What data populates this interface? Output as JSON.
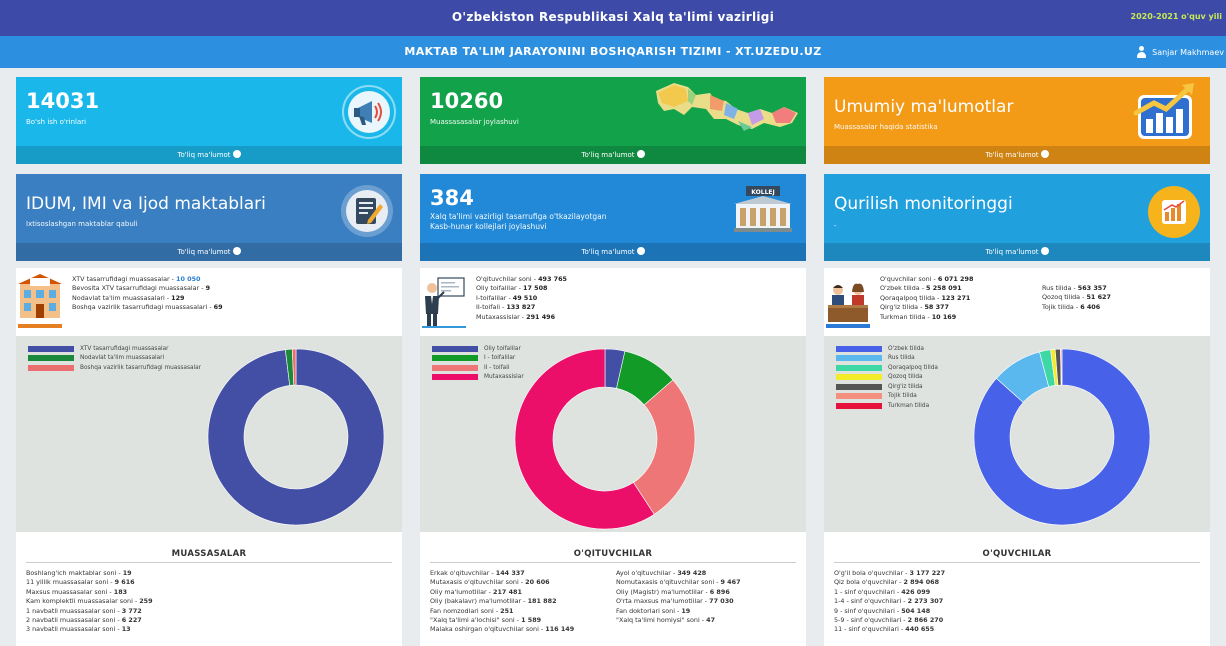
{
  "header": {
    "title": "O'zbekiston Respublikasi Xalq ta'limi vazirligi",
    "year": "2020-2021 o'quv yili"
  },
  "subheader": {
    "title": "MAKTAB TA'LIM JARAYONINI BOSHQARISH TIZIMI - XT.UZEDU.UZ",
    "user": "Sanjar Makhmaev"
  },
  "more_label": "To'liq ma'lumot",
  "cards": [
    {
      "value": "14031",
      "subtitle": "Bo'sh ish o'rinlari",
      "color": "#1ab8ea",
      "icon": "megaphone-icon"
    },
    {
      "value": "10260",
      "subtitle": "Muassasasalar joylashuvi",
      "color": "#12a24a",
      "icon": "map-icon"
    },
    {
      "title": "Umumiy ma'lumotlar",
      "subtitle": "Muassasalar haqida statistika",
      "color": "#f39a17",
      "icon": "growth-chart-icon"
    },
    {
      "title": "IDUM, IMI va Ijod maktablari",
      "subtitle": "Ixtisoslashgan maktablar qabuli",
      "color": "#3a7fc2",
      "icon": "edit-document-icon"
    },
    {
      "value": "384",
      "subtitle": "Xalq ta'limi vazirligi tasarrufiga o'tkazilayotgan",
      "subtitle2": "Kasb-hunar kollejlari joylashuvi",
      "color": "#2189d8",
      "icon": "college-building-icon",
      "icon_label": "KOLLEJ"
    },
    {
      "title": "Qurilish monitoringgi",
      "subtitle": "-",
      "color": "#21a0de",
      "icon": "bar-chart-icon"
    }
  ],
  "panels": {
    "institutions": {
      "info": [
        {
          "label": "XTV tasarrufidagi muassasalar - ",
          "value": "10 050"
        },
        {
          "label": "Bevosita XTV tasarrufidagi muassasalar - ",
          "value": "9"
        },
        {
          "label": "Nodavlat ta'lim muassasalari - ",
          "value": "129"
        },
        {
          "label": "Boshqa vazirlik tasarrufidagi muassasalari - ",
          "value": "69"
        }
      ],
      "title": "MUASSASALAR",
      "list": [
        {
          "label": "Boshlang'ich maktablar soni - ",
          "value": "19"
        },
        {
          "label": "11 yillik muassasalar soni - ",
          "value": "9 616"
        },
        {
          "label": "Maxsus muassasalar soni - ",
          "value": "183"
        },
        {
          "label": "Kam komplektli muassasalar soni - ",
          "value": "259"
        },
        {
          "label": "1 navbatli muassasalar soni - ",
          "value": "3 772"
        },
        {
          "label": "2 navbatli muassasalar soni - ",
          "value": "6 227"
        },
        {
          "label": "3 navbatli muassasalar soni - ",
          "value": "13"
        }
      ]
    },
    "teachers": {
      "info": [
        {
          "label": "O'qituvchilar soni - ",
          "value": "493 765"
        },
        {
          "label": "Oliy toifalilar - ",
          "value": "17 508"
        },
        {
          "label": "I-toifalilar - ",
          "value": "49 510"
        },
        {
          "label": "II-toifali - ",
          "value": "133 827"
        },
        {
          "label": "Mutaxassislar - ",
          "value": "291 496"
        }
      ],
      "title": "O'QITUVCHILAR",
      "list_left": [
        {
          "label": "Erkak o'qituvchilar - ",
          "value": "144 337"
        },
        {
          "label": "Mutaxasis o'qituvchilar soni - ",
          "value": "20 606"
        },
        {
          "label": "Oliy ma'lumotlilar - ",
          "value": "217 481"
        },
        {
          "label": "Oliy (bakalavr) ma'lumotlilar - ",
          "value": "181 882"
        },
        {
          "label": "Fan nomzodlari soni - ",
          "value": "251"
        },
        {
          "label": "\"Xalq ta'limi a'lochisi\" soni - ",
          "value": "1 589"
        },
        {
          "label": "Malaka oshirgan o'qituvchilar soni - ",
          "value": "116 149"
        }
      ],
      "list_right": [
        {
          "label": "Ayol o'qituvchilar - ",
          "value": "349 428"
        },
        {
          "label": "Nomutaxasis o'qituvchilar soni - ",
          "value": "9 467"
        },
        {
          "label": "Oliy (Magistr) ma'lumotlilar - ",
          "value": "6 896"
        },
        {
          "label": "O'rta maxsus ma'lumotlilar - ",
          "value": "77 030"
        },
        {
          "label": "Fan doktorlari soni - ",
          "value": "19"
        },
        {
          "label": "\"Xalq ta'limi homiysi\" soni - ",
          "value": "47"
        }
      ]
    },
    "students": {
      "info_left": [
        {
          "label": "O'quvchilar soni - ",
          "value": "6 071 298"
        },
        {
          "label": "O'zbek tilida - ",
          "value": "5 258 091"
        },
        {
          "label": "Qoraqalpoq tilida - ",
          "value": "123 271"
        },
        {
          "label": "Qirg'iz tilida - ",
          "value": "58 377"
        },
        {
          "label": "Turkman tilida - ",
          "value": "10 169"
        }
      ],
      "info_right": [
        {
          "label": "Rus tilida - ",
          "value": "563 357"
        },
        {
          "label": "Qozoq tilida - ",
          "value": "51 627"
        },
        {
          "label": "Tojik tilida - ",
          "value": "6 406"
        }
      ],
      "title": "O'QUVCHILAR",
      "list": [
        {
          "label": "O'g'il bola o'quvchilar - ",
          "value": "3 177 227"
        },
        {
          "label": "Qiz bola o'quvchilar - ",
          "value": "2 894 068"
        },
        {
          "label": "1 - sinf o'quvchilari - ",
          "value": "426 099"
        },
        {
          "label": "1-4 - sinf o'quvchilari - ",
          "value": "2 273 307"
        },
        {
          "label": "9 - sinf o'quvchilari - ",
          "value": "504 148"
        },
        {
          "label": "5-9 - sinf o'quvchilari - ",
          "value": "2 866 270"
        },
        {
          "label": "11 - sinf o'quvchilari - ",
          "value": "440 655"
        }
      ]
    }
  },
  "chart_data": [
    {
      "type": "pie",
      "labels": [
        "XTV tasarrufidagi muassasalar",
        "Nodavlat ta'lim muassasalari",
        "Boshqa vazirlik tasarrufidagi muassasalar"
      ],
      "values": [
        10050,
        129,
        69
      ],
      "colors": [
        "#434fa4",
        "#1a8a3a",
        "#ec6f6f"
      ],
      "legend": "top-left"
    },
    {
      "type": "pie",
      "labels": [
        "Oliy toifalilar",
        "I - toifalilar",
        "II - toifali",
        "Mutaxassislar"
      ],
      "values": [
        17508,
        49510,
        133827,
        291496
      ],
      "colors": [
        "#434fa4",
        "#129b27",
        "#ef7676",
        "#eb0f6a"
      ],
      "legend": "top-left"
    },
    {
      "type": "pie",
      "labels": [
        "O'zbek tilida",
        "Rus tilida",
        "Qoraqalpoq tilida",
        "Qozoq tilida",
        "Qirg'iz tilida",
        "Tojik tilida",
        "Turkman tilida"
      ],
      "values": [
        5258091,
        563357,
        123271,
        51627,
        58377,
        6406,
        10169
      ],
      "colors": [
        "#4762e8",
        "#5ab8ef",
        "#3ed8a6",
        "#f4ec28",
        "#555555",
        "#f4907f",
        "#e5123c"
      ],
      "legend": "top-left"
    }
  ]
}
